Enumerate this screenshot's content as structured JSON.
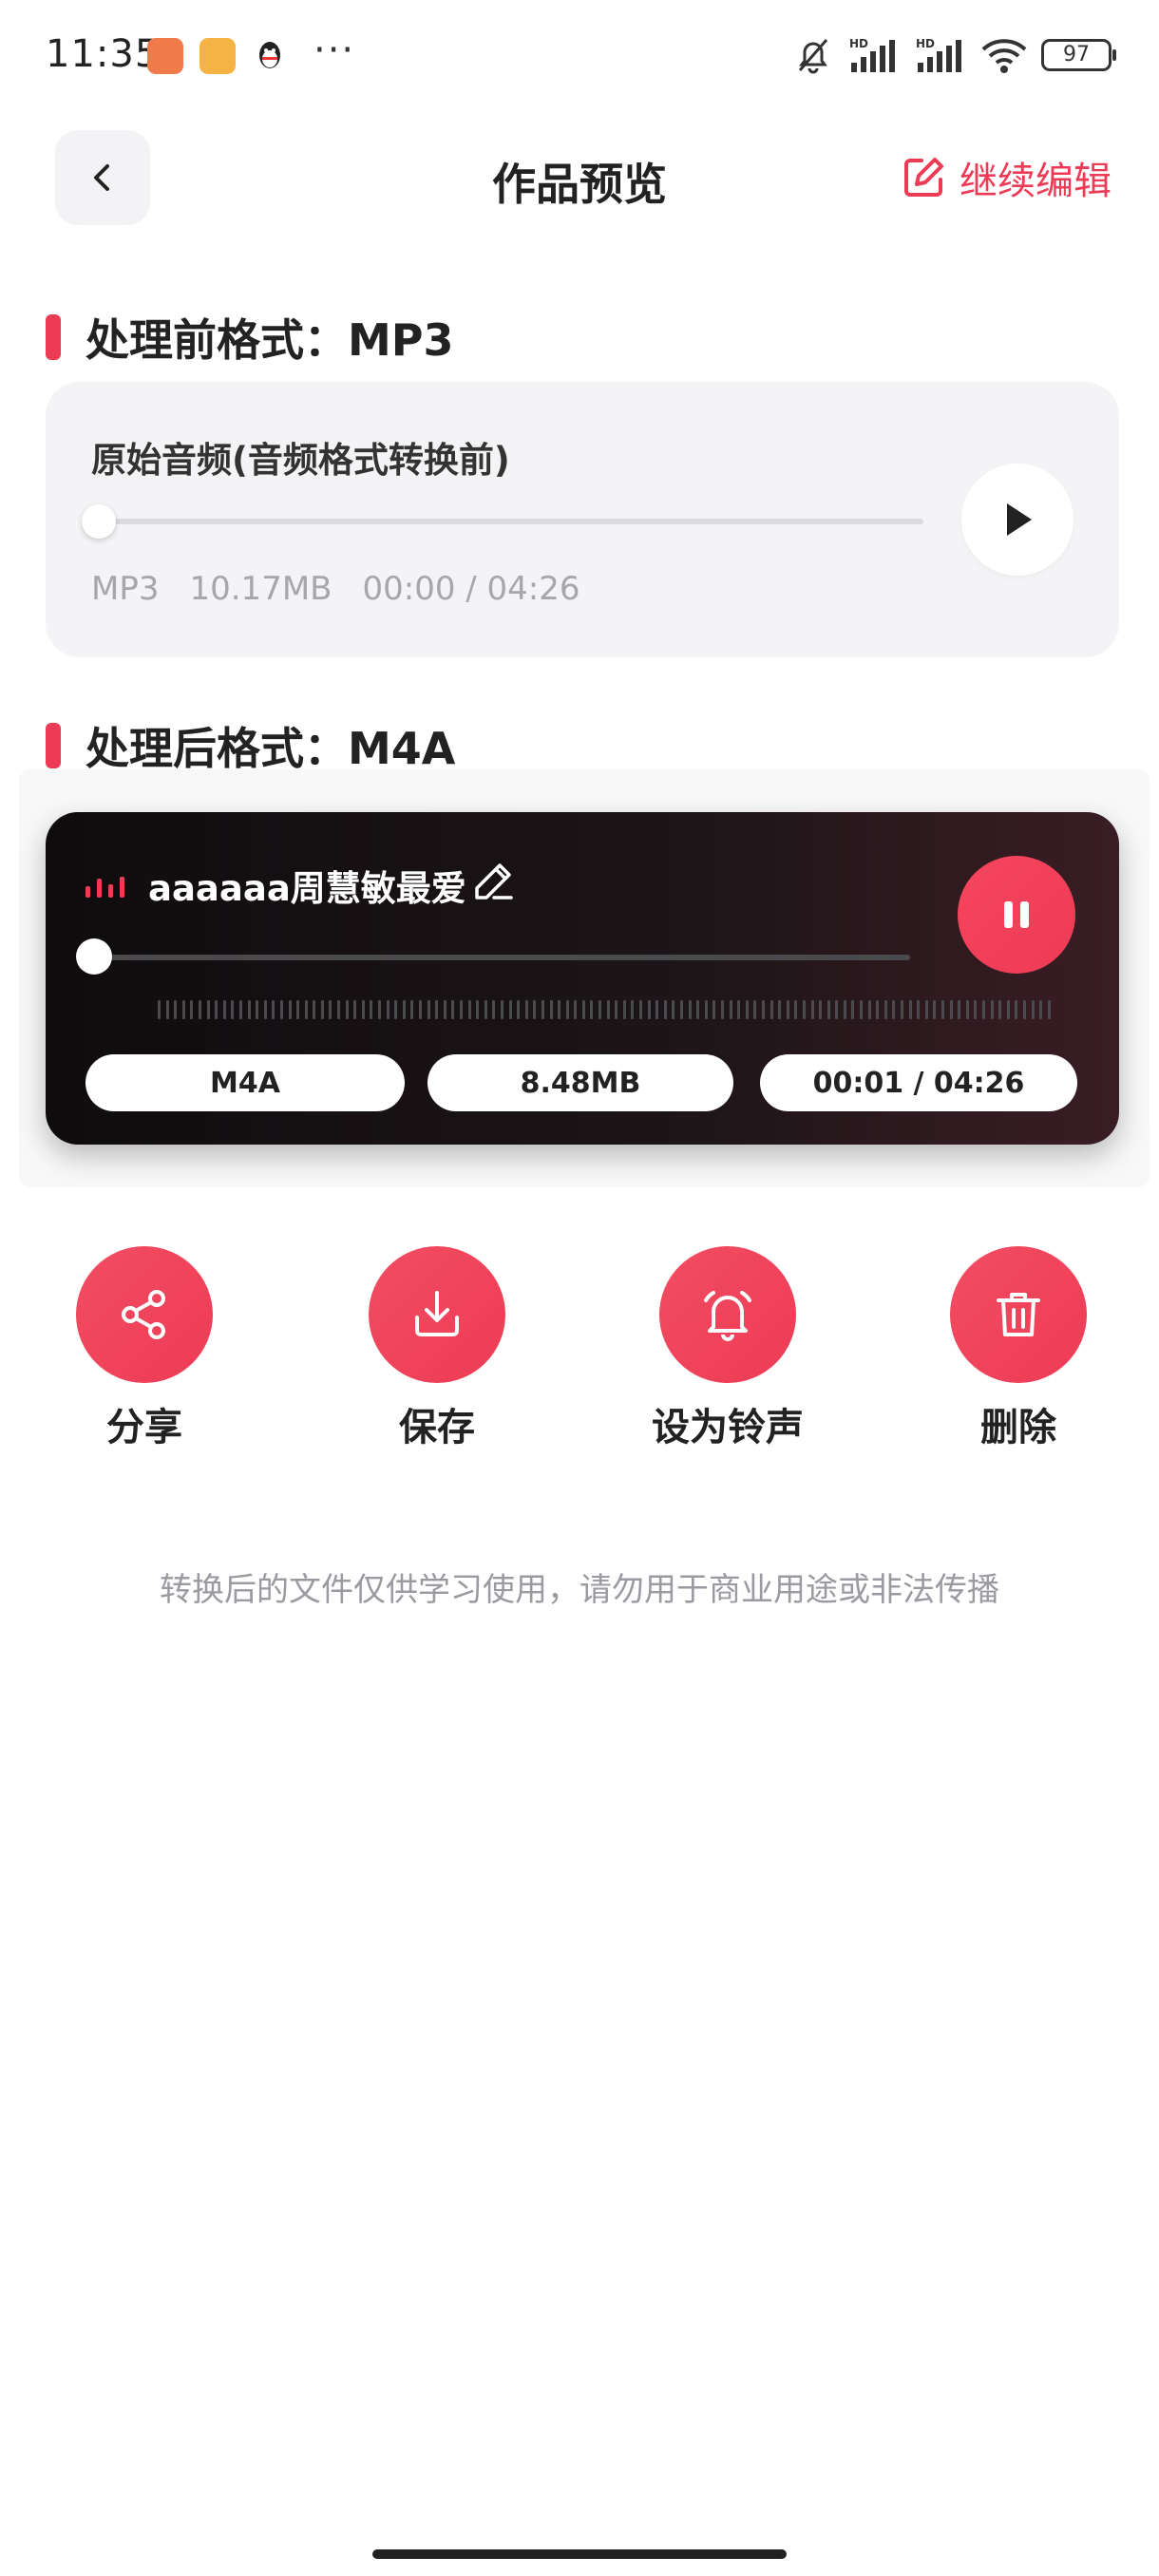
{
  "status_bar": {
    "time": "11:35",
    "more": "···",
    "battery": "97"
  },
  "header": {
    "title": "作品预览",
    "edit_label": "继续编辑"
  },
  "before": {
    "section_title": "处理前格式：MP3",
    "card_title": "原始音频(音频格式转换前)",
    "format": "MP3",
    "size": "10.17MB",
    "time": "00:00 / 04:26",
    "progress": 0.0
  },
  "after": {
    "section_title": "处理后格式：M4A",
    "file_name": "aaaaaa周慧敏最爱",
    "format": "M4A",
    "size": "8.48MB",
    "time": "00:01 / 04:26",
    "progress": 0.004,
    "state": "playing"
  },
  "actions": {
    "share": "分享",
    "save": "保存",
    "ringtone": "设为铃声",
    "delete": "删除"
  },
  "disclaimer": "转换后的文件仅供学习使用，请勿用于商业用途或非法传播",
  "colors": {
    "accent": "#ee3b55",
    "card_dark": "#1d1518",
    "card_light": "#f4f4f6"
  }
}
